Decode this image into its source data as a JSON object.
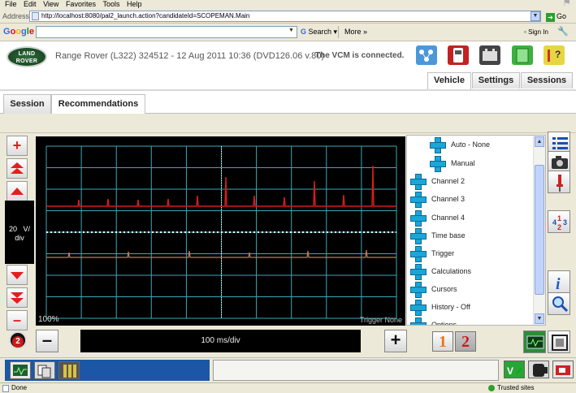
{
  "browser": {
    "menu": [
      "File",
      "Edit",
      "View",
      "Favorites",
      "Tools",
      "Help"
    ],
    "address_label": "Address",
    "url": "http://localhost:8080/pal2_launch.action?candidateId=SCOPEMAN.Main",
    "go_label": "Go",
    "google_search": "Search",
    "google_more": "More »",
    "sign_in": "Sign In",
    "status_done": "Done",
    "status_zone": "Trusted sites"
  },
  "header": {
    "logo_text": "LAND ROVER",
    "vehicle_info": "Range Rover (L322) 324512 - 12 Aug 2011 10:36 (DVD126.06 v.80)",
    "vcm_status": "The VCM is connected."
  },
  "top_tabs": [
    {
      "label": "Vehicle",
      "active": true
    },
    {
      "label": "Settings",
      "active": false
    },
    {
      "label": "Sessions",
      "active": false
    }
  ],
  "sub_tabs": [
    {
      "label": "Session",
      "active": false
    },
    {
      "label": "Recommendations",
      "active": true
    }
  ],
  "scope": {
    "volts_value": "20",
    "volts_unit": "V/",
    "volts_suffix": "div",
    "zoom_label": "100%",
    "trigger_label": "Trigger None",
    "timebase_label": "100 ms/div",
    "channel_badge": "2",
    "trace1_color": "#d41c1c",
    "trace2_color": "#c87a4a",
    "grid_color": "#3aa9b8"
  },
  "tree_items": [
    {
      "label": "Auto - None",
      "indent": 1
    },
    {
      "label": "Manual",
      "indent": 1
    },
    {
      "label": "Channel 2",
      "indent": 0
    },
    {
      "label": "Channel 3",
      "indent": 0
    },
    {
      "label": "Channel 4",
      "indent": 0
    },
    {
      "label": "Time base",
      "indent": 0
    },
    {
      "label": "Trigger",
      "indent": 0
    },
    {
      "label": "Calculations",
      "indent": 0
    },
    {
      "label": "Cursors",
      "indent": 0
    },
    {
      "label": "History - Off",
      "indent": 0
    },
    {
      "label": "Options",
      "indent": 0
    }
  ],
  "channel_buttons": [
    {
      "label": "1",
      "color": "#e8781a"
    },
    {
      "label": "2",
      "color": "#d01818"
    }
  ]
}
